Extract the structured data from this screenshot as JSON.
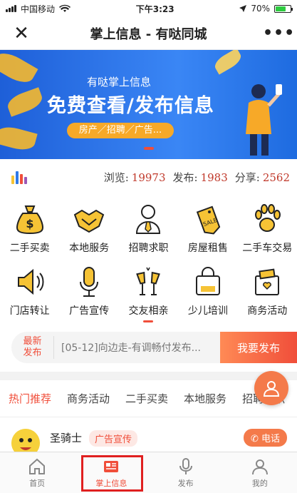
{
  "status_bar": {
    "carrier": "中国移动",
    "time": "下午3:23",
    "battery": "70%",
    "battery_level": 0.7
  },
  "navbar": {
    "close_icon": "close-icon",
    "title": "掌上信息 - 有哒同城",
    "more_icon": "more-icon"
  },
  "banner": {
    "subtitle": "有哒掌上信息",
    "headline": "免费查看/发布信息",
    "pill_text": "房产／招聘／广告..."
  },
  "stats": {
    "views_label": "浏览:",
    "views": "19973",
    "posts_label": "发布:",
    "posts": "1983",
    "shares_label": "分享:",
    "shares": "2562"
  },
  "categories": [
    {
      "label": "二手买卖",
      "icon": "money-bag-icon"
    },
    {
      "label": "本地服务",
      "icon": "handshake-icon"
    },
    {
      "label": "招聘求职",
      "icon": "person-tie-icon"
    },
    {
      "label": "房屋租售",
      "icon": "sale-tag-icon"
    },
    {
      "label": "二手车交易",
      "icon": "paw-icon"
    },
    {
      "label": "门店转让",
      "icon": "speaker-icon"
    },
    {
      "label": "广告宣传",
      "icon": "microphone-icon"
    },
    {
      "label": "交友相亲",
      "icon": "cheers-icon"
    },
    {
      "label": "少儿培训",
      "icon": "shopping-bag-icon"
    },
    {
      "label": "商务活动",
      "icon": "gift-box-icon"
    }
  ],
  "news": {
    "tag_line1": "最新",
    "tag_line2": "发布",
    "text": "[05-12]向边走-有调畅付发布...",
    "publish_button": "我要发布"
  },
  "tabs": [
    "热门推荐",
    "商务活动",
    "二手买卖",
    "本地服务",
    "招聘求职"
  ],
  "post": {
    "name": "圣骑士",
    "badge": "广告宣传",
    "call_button": "电话"
  },
  "tabbar": [
    {
      "label": "首页",
      "icon": "home-icon"
    },
    {
      "label": "掌上信息",
      "icon": "news-icon"
    },
    {
      "label": "发布",
      "icon": "microphone-icon"
    },
    {
      "label": "我的",
      "icon": "user-icon"
    }
  ],
  "colors": {
    "accent": "#f04e3a",
    "banner_blue": "#2f7ae8",
    "icon_yellow": "#f6c335"
  }
}
